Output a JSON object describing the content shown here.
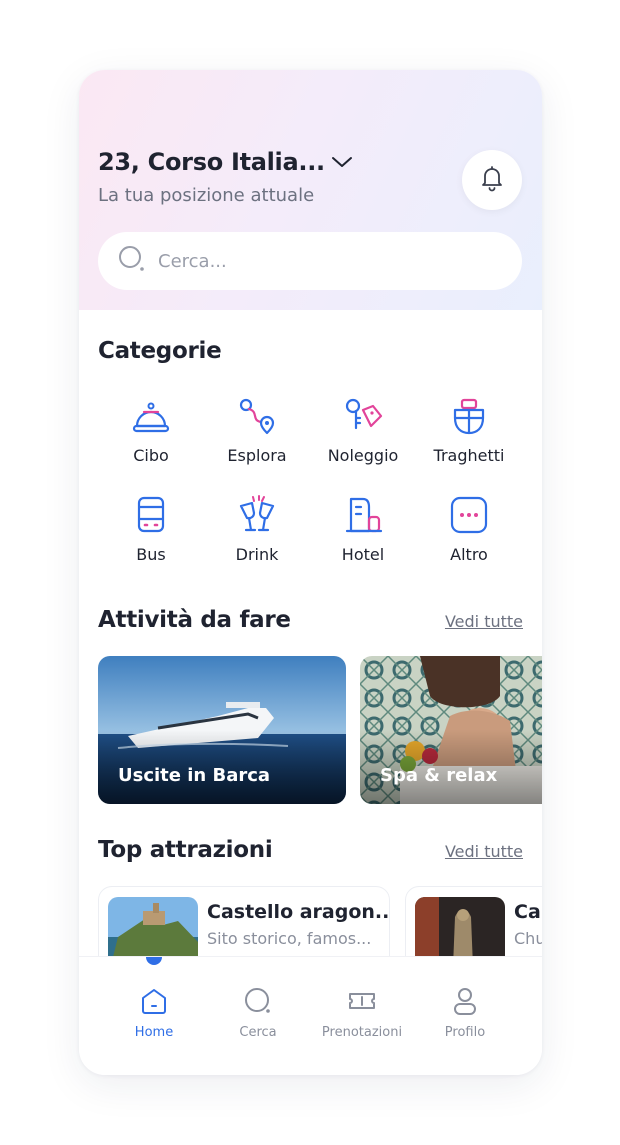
{
  "header": {
    "location_title": "23, Corso Italia...",
    "location_subtitle": "La tua posizione attuale"
  },
  "search": {
    "placeholder": "Cerca..."
  },
  "categories": {
    "title": "Categorie",
    "items": [
      {
        "label": "Cibo",
        "icon": "food-cloche-icon"
      },
      {
        "label": "Esplora",
        "icon": "route-pin-icon"
      },
      {
        "label": "Noleggio",
        "icon": "key-tag-icon"
      },
      {
        "label": "Traghetti",
        "icon": "ferry-icon"
      },
      {
        "label": "Bus",
        "icon": "bus-icon"
      },
      {
        "label": "Drink",
        "icon": "cheers-glasses-icon"
      },
      {
        "label": "Hotel",
        "icon": "hotel-building-icon"
      },
      {
        "label": "Altro",
        "icon": "more-dots-icon"
      }
    ]
  },
  "activities": {
    "title": "Attività da fare",
    "see_all": "Vedi tutte",
    "cards": [
      {
        "label": "Uscite in Barca"
      },
      {
        "label": "Spa & relax"
      }
    ]
  },
  "attractions": {
    "title": "Top attrazioni",
    "see_all": "Vedi tutte",
    "items": [
      {
        "title": "Castello aragon...",
        "subtitle": "Sito storico, famos..."
      },
      {
        "title": "Ca",
        "subtitle": "Chu"
      }
    ]
  },
  "tabbar": {
    "items": [
      {
        "label": "Home",
        "icon": "home-icon"
      },
      {
        "label": "Cerca",
        "icon": "search-icon"
      },
      {
        "label": "Prenotazioni",
        "icon": "ticket-icon"
      },
      {
        "label": "Profilo",
        "icon": "user-icon"
      }
    ],
    "active": "Home"
  },
  "colors": {
    "accent_blue": "#2f6ee6",
    "accent_pink": "#e2449a",
    "text_dark": "#1f2330",
    "text_muted": "#6c7180"
  }
}
